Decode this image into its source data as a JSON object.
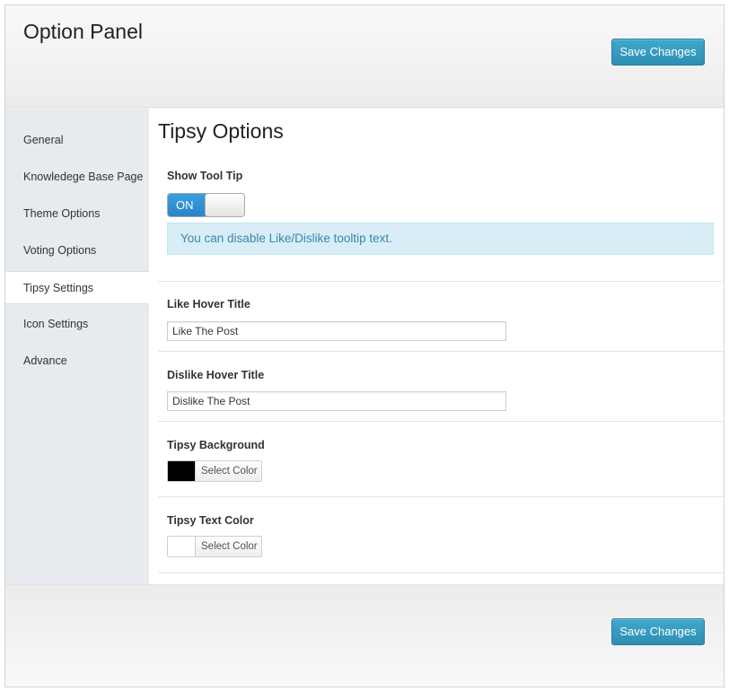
{
  "header": {
    "title": "Option Panel",
    "save_label": "Save Changes"
  },
  "sidebar": {
    "items": [
      {
        "label": "General"
      },
      {
        "label": "Knowledege Base Page"
      },
      {
        "label": "Theme Options"
      },
      {
        "label": "Voting Options"
      },
      {
        "label": "Tipsy Settings",
        "active": true
      },
      {
        "label": "Icon Settings"
      },
      {
        "label": "Advance"
      }
    ]
  },
  "main": {
    "title": "Tipsy Options",
    "show_tooltip": {
      "label": "Show Tool Tip",
      "state": "ON",
      "info": "You can disable Like/Dislike tooltip text."
    },
    "like_hover": {
      "label": "Like Hover Title",
      "value": "Like The Post"
    },
    "dislike_hover": {
      "label": "Dislike Hover Title",
      "value": "Dislike The Post"
    },
    "tipsy_background": {
      "label": "Tipsy Background",
      "picker_label": "Select Color",
      "color": "#000000"
    },
    "tipsy_text_color": {
      "label": "Tipsy Text Color",
      "picker_label": "Select Color",
      "color": "#ffffff"
    }
  },
  "footer": {
    "save_label": "Save Changes"
  },
  "colors": {
    "accent": "#2e8eb2",
    "info_bg": "#d9edf7",
    "info_text": "#3a87ad",
    "toggle_on": "#2a85c9"
  }
}
